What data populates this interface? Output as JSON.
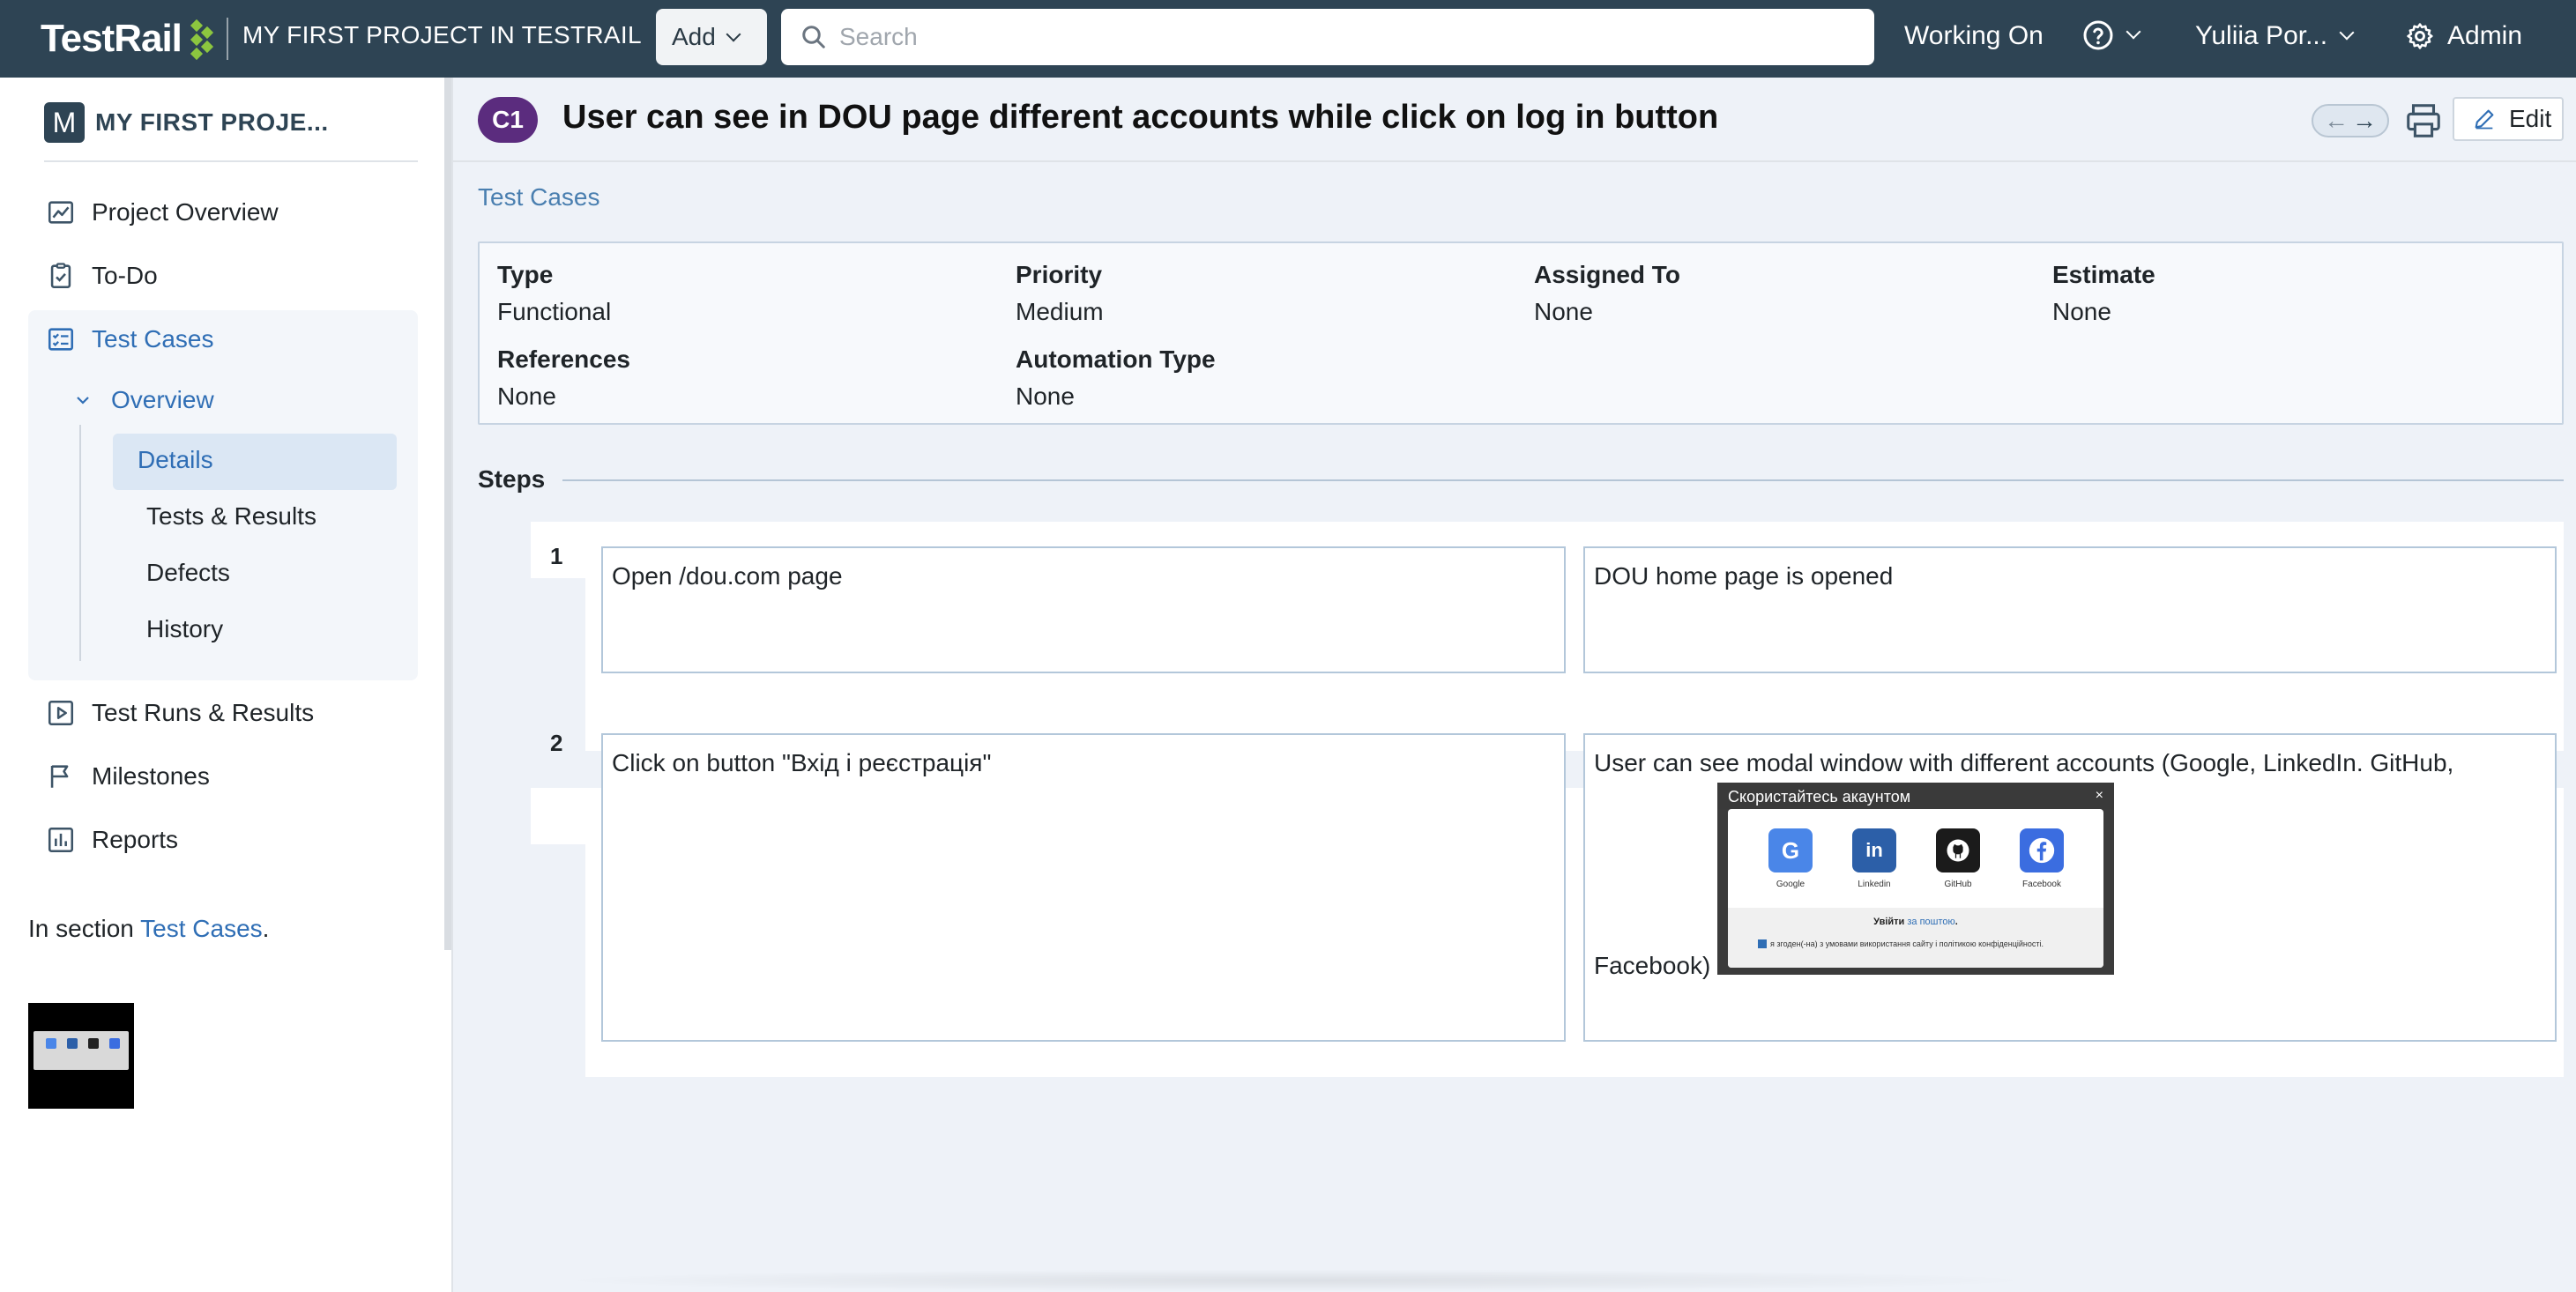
{
  "topbar": {
    "logo": "TestRail",
    "project_title": "MY FIRST PROJECT IN TESTRAIL",
    "add_label": "Add",
    "search_placeholder": "Search",
    "working_on": "Working On",
    "user_name": "Yuliia Por...",
    "admin": "Admin"
  },
  "sidebar": {
    "avatar_letter": "M",
    "project_name": "MY FIRST PROJE...",
    "items": {
      "project_overview": "Project Overview",
      "todo": "To-Do",
      "test_cases": "Test Cases",
      "overview": "Overview",
      "details": "Details",
      "tests_results": "Tests & Results",
      "defects": "Defects",
      "history": "History",
      "test_runs": "Test Runs & Results",
      "milestones": "Milestones",
      "reports": "Reports"
    },
    "in_section_prefix": "In section",
    "in_section_link": "Test Cases",
    "in_section_suffix": "."
  },
  "case": {
    "id_badge": "C1",
    "title": "User can see in DOU page different accounts while click on log in button",
    "edit_label": "Edit",
    "breadcrumb": "Test Cases"
  },
  "properties": {
    "type_label": "Type",
    "type_value": "Functional",
    "priority_label": "Priority",
    "priority_value": "Medium",
    "assigned_label": "Assigned To",
    "assigned_value": "None",
    "estimate_label": "Estimate",
    "estimate_value": "None",
    "references_label": "References",
    "references_value": "None",
    "automation_label": "Automation Type",
    "automation_value": "None"
  },
  "steps": {
    "title": "Steps",
    "items": [
      {
        "num": "1",
        "action": "Open /dou.com page",
        "expected": "DOU home page is opened"
      },
      {
        "num": "2",
        "action": "Click on button \"Вхід і реєстрація\"",
        "expected_line1": "User can see modal window with different accounts (Google, LinkedIn. GitHub,",
        "expected_line2": "Facebook)"
      }
    ]
  },
  "modal": {
    "title": "Скористайтесь акаунтом",
    "close": "×",
    "accounts": [
      "Google",
      "Linkedin",
      "GitHub",
      "Facebook"
    ],
    "mail_prefix": "Увійти",
    "mail_link": "за поштою",
    "mail_suffix": ".",
    "agree_text": "я згоден(-на) з умовами використання сайту і політикою конфіденційності."
  },
  "colors": {
    "topbar": "#2e4454",
    "accent_blue": "#2f6eb5",
    "badge_purple": "#5b2c7e",
    "logo_green": "#8cc63f"
  }
}
